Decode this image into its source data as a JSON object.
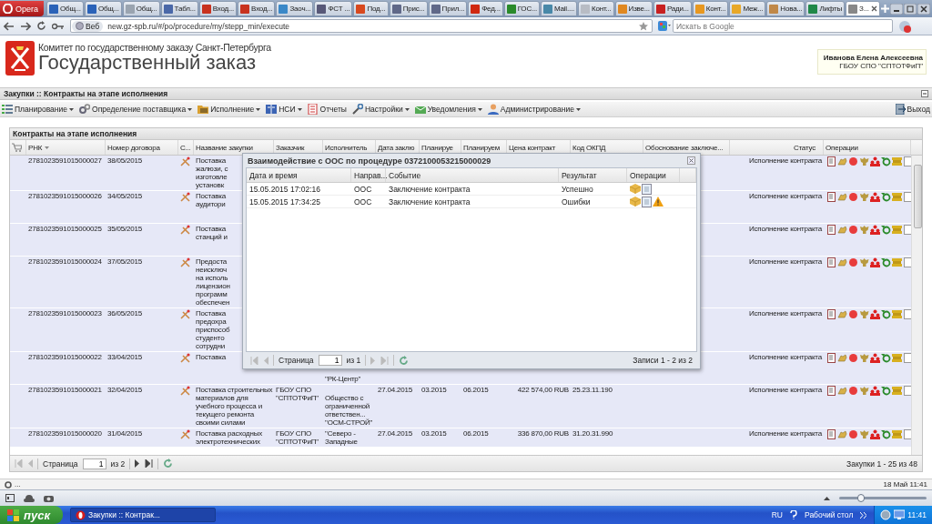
{
  "browser": {
    "menu_button": "Opera",
    "tabs": [
      {
        "label": "Общ...",
        "selected": false,
        "color": "#2a62b8"
      },
      {
        "label": "Общ...",
        "selected": false,
        "color": "#2a62b8"
      },
      {
        "label": "Общ...",
        "selected": false,
        "color": "#9aa4b0"
      },
      {
        "label": "Табл...",
        "selected": false,
        "color": "#4a68a8"
      },
      {
        "label": "Вход...",
        "selected": false,
        "color": "#c8321e"
      },
      {
        "label": "Вход...",
        "selected": false,
        "color": "#c8321e"
      },
      {
        "label": "Заоч...",
        "selected": false,
        "color": "#3a88c8"
      },
      {
        "label": "ФСТ ...",
        "selected": false,
        "color": "#585878"
      },
      {
        "label": "Под...",
        "selected": false,
        "color": "#d8481e"
      },
      {
        "label": "Прис...",
        "selected": false,
        "color": "#606888"
      },
      {
        "label": "Прил...",
        "selected": false,
        "color": "#606888"
      },
      {
        "label": "Фед...",
        "selected": false,
        "color": "#d02810"
      },
      {
        "label": "ГОС...",
        "selected": false,
        "color": "#2a8a2a"
      },
      {
        "label": "Mail....",
        "selected": false,
        "color": "#4888a8"
      },
      {
        "label": "Конт...",
        "selected": false,
        "color": "#b8bcc4"
      },
      {
        "label": "Изве...",
        "selected": false,
        "color": "#e08820"
      },
      {
        "label": "Ради...",
        "selected": false,
        "color": "#c82020"
      },
      {
        "label": "Конт...",
        "selected": false,
        "color": "#e89820"
      },
      {
        "label": "Меж...",
        "selected": false,
        "color": "#e8a828"
      },
      {
        "label": "Нова...",
        "selected": false,
        "color": "#c08848"
      },
      {
        "label": "Лифты",
        "selected": false,
        "color": "#208848"
      },
      {
        "label": "З...",
        "selected": true,
        "color": "#888888"
      }
    ],
    "address_badge": "Веб",
    "address": "new.gz-spb.ru/#/po/procedure/my/stepp_min/execute",
    "search_placeholder": "Искать в Google"
  },
  "header": {
    "org": "Комитет по государственному заказу Санкт-Петербурга",
    "title": "Государственный заказ",
    "user": {
      "name": "Иванова Елена Алексеевна",
      "org": "ГБОУ СПО \"СПТОТФиП\""
    }
  },
  "breadcrumb": "Закупки :: Контракты на этапе исполнения",
  "menu": [
    {
      "label": "Планирование",
      "dropdown": true
    },
    {
      "label": "Определение поставщика",
      "dropdown": true
    },
    {
      "label": "Исполнение",
      "dropdown": true
    },
    {
      "label": "НСИ",
      "dropdown": true
    },
    {
      "label": "Отчеты",
      "dropdown": false
    },
    {
      "label": "Настройки",
      "dropdown": true
    },
    {
      "label": "Уведомления",
      "dropdown": true
    },
    {
      "label": "Администрирование",
      "dropdown": true
    }
  ],
  "logout": "Выход",
  "panel": {
    "title": "Контракты на этапе исполнения",
    "columns": [
      "РНК",
      "Номер договора",
      "С...",
      "Название закупки",
      "Заказчик",
      "Исполнитель",
      "Дата заклю",
      "Планируе",
      "Планируем",
      "Цена контракт",
      "Код ОКПД",
      "Обоснование заключе...",
      "Статус",
      "Операции"
    ],
    "rows": [
      {
        "rnk": "2781023591015000027",
        "number": "38/05/2015",
        "name": "Поставка\nжалюзи, с\nизготовле\nустановк",
        "status": "Исполнение контракта"
      },
      {
        "rnk": "2781023591015000026",
        "number": "34/05/2015",
        "name": "Поставка\nаудитори",
        "status": "Исполнение контракта"
      },
      {
        "rnk": "2781023591015000025",
        "number": "35/05/2015",
        "name": "Поставка\nстанций и",
        "status": "Исполнение контракта"
      },
      {
        "rnk": "2781023591015000024",
        "number": "37/05/2015",
        "name": "Предоста\nнеисключ\nна исполь\nлицензион\nпрограмм\nобеспечен",
        "status": "Исполнение контракта"
      },
      {
        "rnk": "2781023591015000023",
        "number": "36/05/2015",
        "name": "Поставка\nпредохра\nприспособ\nстуденто\nсотрудни",
        "status": "Исполнение контракта"
      },
      {
        "rnk": "2781023591015000022",
        "number": "33/04/2015",
        "name": "Поставка",
        "executor": "\"РК-Центр\"",
        "status": "Исполнение контракта"
      },
      {
        "rnk": "2781023591015000021",
        "number": "32/04/2015",
        "name": "Поставка строительных\nматериалов для\nучебного процесса и\nтекущего ремонта\nсвоими силами",
        "customer": "ГБОУ СПО\n\"СПТОТФиП\"",
        "executor": "Общество с\nограниченной\nответствен...\n\"ОСМ-СТРОЙ\"",
        "date": "27.04.2015",
        "plan_start": "03.2015",
        "plan_end": "06.2015",
        "price": "422 574,00 RUB",
        "okpd": "25.23.11.190",
        "status": "Исполнение контракта"
      },
      {
        "rnk": "2781023591015000020",
        "number": "31/04/2015",
        "name": "Поставка расходных\nэлектротехнических",
        "customer": "ГБОУ СПО\n\"СПТОТФиП\"",
        "executor": "\"Северо -\nЗападные",
        "date": "27.04.2015",
        "plan_start": "03.2015",
        "plan_end": "06.2015",
        "price": "336 870,00 RUB",
        "okpd": "31.20.31.990",
        "status": "Исполнение контракта"
      }
    ],
    "pager": {
      "page_label": "Страница",
      "page": "1",
      "of": "из 2",
      "summary": "Закупки 1 - 25 из 48"
    }
  },
  "dialog": {
    "title": "Взаимодействие с ООС по процедуре 0372100053215000029",
    "columns": [
      "Дата и время",
      "Направ...",
      "Событие",
      "Результат",
      "Операции"
    ],
    "rows": [
      {
        "datetime": "15.05.2015 17:02:16",
        "direction": "ООС",
        "event": "Заключение контракта",
        "result": "Успешно",
        "warning": false
      },
      {
        "datetime": "15.05.2015 17:34:25",
        "direction": "ООС",
        "event": "Заключение контракта",
        "result": "Ошибки",
        "warning": true
      }
    ],
    "pager": {
      "page_label": "Страница",
      "page": "1",
      "of": "из 1",
      "summary": "Записи 1 - 2 из 2"
    }
  },
  "status_bar": {
    "left": "...",
    "right": "18 Май 11:41"
  },
  "zoom_slider": {
    "level": 0.25
  },
  "taskbar": {
    "start": "пуск",
    "tasks": [
      {
        "label": "Закупки :: Контрак...",
        "selected": true
      }
    ],
    "lang": "RU",
    "desktop": "Рабочий стол",
    "clock": "11:41"
  }
}
